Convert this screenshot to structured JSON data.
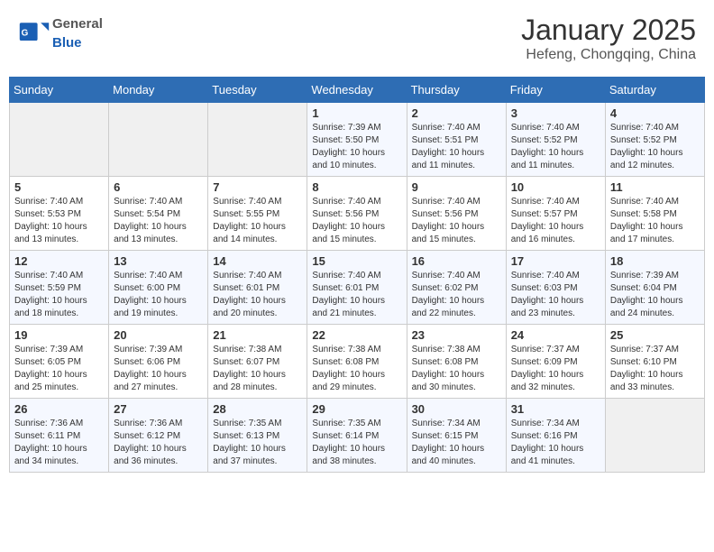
{
  "logo": {
    "general": "General",
    "blue": "Blue"
  },
  "title": "January 2025",
  "subtitle": "Hefeng, Chongqing, China",
  "days_of_week": [
    "Sunday",
    "Monday",
    "Tuesday",
    "Wednesday",
    "Thursday",
    "Friday",
    "Saturday"
  ],
  "weeks": [
    {
      "days": [
        {
          "num": "",
          "info": ""
        },
        {
          "num": "",
          "info": ""
        },
        {
          "num": "",
          "info": ""
        },
        {
          "num": "1",
          "info": "Sunrise: 7:39 AM\nSunset: 5:50 PM\nDaylight: 10 hours\nand 10 minutes."
        },
        {
          "num": "2",
          "info": "Sunrise: 7:40 AM\nSunset: 5:51 PM\nDaylight: 10 hours\nand 11 minutes."
        },
        {
          "num": "3",
          "info": "Sunrise: 7:40 AM\nSunset: 5:52 PM\nDaylight: 10 hours\nand 11 minutes."
        },
        {
          "num": "4",
          "info": "Sunrise: 7:40 AM\nSunset: 5:52 PM\nDaylight: 10 hours\nand 12 minutes."
        }
      ]
    },
    {
      "days": [
        {
          "num": "5",
          "info": "Sunrise: 7:40 AM\nSunset: 5:53 PM\nDaylight: 10 hours\nand 13 minutes."
        },
        {
          "num": "6",
          "info": "Sunrise: 7:40 AM\nSunset: 5:54 PM\nDaylight: 10 hours\nand 13 minutes."
        },
        {
          "num": "7",
          "info": "Sunrise: 7:40 AM\nSunset: 5:55 PM\nDaylight: 10 hours\nand 14 minutes."
        },
        {
          "num": "8",
          "info": "Sunrise: 7:40 AM\nSunset: 5:56 PM\nDaylight: 10 hours\nand 15 minutes."
        },
        {
          "num": "9",
          "info": "Sunrise: 7:40 AM\nSunset: 5:56 PM\nDaylight: 10 hours\nand 15 minutes."
        },
        {
          "num": "10",
          "info": "Sunrise: 7:40 AM\nSunset: 5:57 PM\nDaylight: 10 hours\nand 16 minutes."
        },
        {
          "num": "11",
          "info": "Sunrise: 7:40 AM\nSunset: 5:58 PM\nDaylight: 10 hours\nand 17 minutes."
        }
      ]
    },
    {
      "days": [
        {
          "num": "12",
          "info": "Sunrise: 7:40 AM\nSunset: 5:59 PM\nDaylight: 10 hours\nand 18 minutes."
        },
        {
          "num": "13",
          "info": "Sunrise: 7:40 AM\nSunset: 6:00 PM\nDaylight: 10 hours\nand 19 minutes."
        },
        {
          "num": "14",
          "info": "Sunrise: 7:40 AM\nSunset: 6:01 PM\nDaylight: 10 hours\nand 20 minutes."
        },
        {
          "num": "15",
          "info": "Sunrise: 7:40 AM\nSunset: 6:01 PM\nDaylight: 10 hours\nand 21 minutes."
        },
        {
          "num": "16",
          "info": "Sunrise: 7:40 AM\nSunset: 6:02 PM\nDaylight: 10 hours\nand 22 minutes."
        },
        {
          "num": "17",
          "info": "Sunrise: 7:40 AM\nSunset: 6:03 PM\nDaylight: 10 hours\nand 23 minutes."
        },
        {
          "num": "18",
          "info": "Sunrise: 7:39 AM\nSunset: 6:04 PM\nDaylight: 10 hours\nand 24 minutes."
        }
      ]
    },
    {
      "days": [
        {
          "num": "19",
          "info": "Sunrise: 7:39 AM\nSunset: 6:05 PM\nDaylight: 10 hours\nand 25 minutes."
        },
        {
          "num": "20",
          "info": "Sunrise: 7:39 AM\nSunset: 6:06 PM\nDaylight: 10 hours\nand 27 minutes."
        },
        {
          "num": "21",
          "info": "Sunrise: 7:38 AM\nSunset: 6:07 PM\nDaylight: 10 hours\nand 28 minutes."
        },
        {
          "num": "22",
          "info": "Sunrise: 7:38 AM\nSunset: 6:08 PM\nDaylight: 10 hours\nand 29 minutes."
        },
        {
          "num": "23",
          "info": "Sunrise: 7:38 AM\nSunset: 6:08 PM\nDaylight: 10 hours\nand 30 minutes."
        },
        {
          "num": "24",
          "info": "Sunrise: 7:37 AM\nSunset: 6:09 PM\nDaylight: 10 hours\nand 32 minutes."
        },
        {
          "num": "25",
          "info": "Sunrise: 7:37 AM\nSunset: 6:10 PM\nDaylight: 10 hours\nand 33 minutes."
        }
      ]
    },
    {
      "days": [
        {
          "num": "26",
          "info": "Sunrise: 7:36 AM\nSunset: 6:11 PM\nDaylight: 10 hours\nand 34 minutes."
        },
        {
          "num": "27",
          "info": "Sunrise: 7:36 AM\nSunset: 6:12 PM\nDaylight: 10 hours\nand 36 minutes."
        },
        {
          "num": "28",
          "info": "Sunrise: 7:35 AM\nSunset: 6:13 PM\nDaylight: 10 hours\nand 37 minutes."
        },
        {
          "num": "29",
          "info": "Sunrise: 7:35 AM\nSunset: 6:14 PM\nDaylight: 10 hours\nand 38 minutes."
        },
        {
          "num": "30",
          "info": "Sunrise: 7:34 AM\nSunset: 6:15 PM\nDaylight: 10 hours\nand 40 minutes."
        },
        {
          "num": "31",
          "info": "Sunrise: 7:34 AM\nSunset: 6:16 PM\nDaylight: 10 hours\nand 41 minutes."
        },
        {
          "num": "",
          "info": ""
        }
      ]
    }
  ]
}
